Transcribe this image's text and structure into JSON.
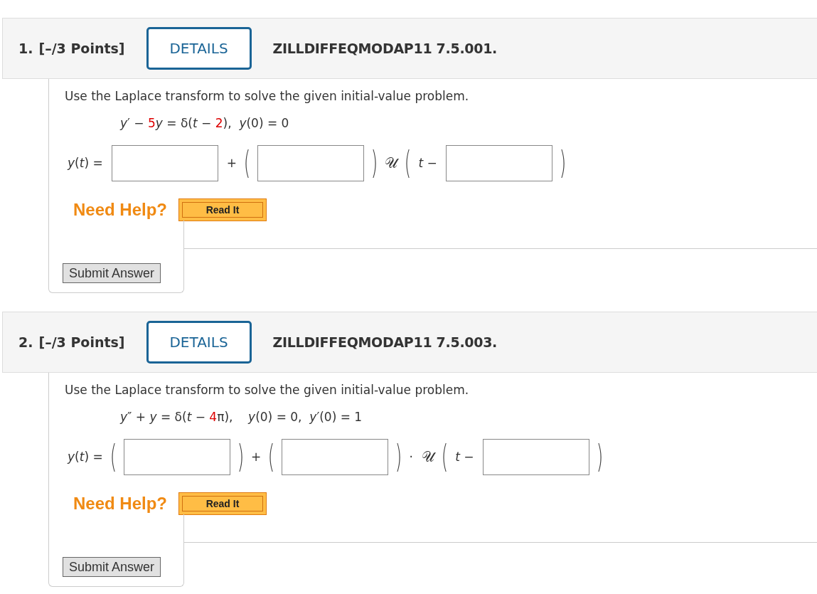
{
  "questions": [
    {
      "number": "1.",
      "points": "[–/3 Points]",
      "details": "DETAILS",
      "code": "ZILLDIFFEQMODAP11 7.5.001.",
      "prompt": "Use the Laplace transform to solve the given initial-value problem.",
      "equation": [
        {
          "kind": "plain",
          "text": "*y*′ − "
        },
        {
          "kind": "param",
          "text": "5"
        },
        {
          "kind": "plain",
          "text": "*y* = δ(*t* − "
        },
        {
          "kind": "param",
          "text": "2"
        },
        {
          "kind": "plain",
          "text": "),  *y*(0) = 0"
        }
      ],
      "answer": [
        {
          "kind": "text",
          "text": "*y*(*t*) ="
        },
        {
          "kind": "blank"
        },
        {
          "kind": "text",
          "text": "+"
        },
        {
          "kind": "paren",
          "text": "("
        },
        {
          "kind": "blank"
        },
        {
          "kind": "paren",
          "text": ")"
        },
        {
          "kind": "script",
          "text": "𝒰"
        },
        {
          "kind": "paren",
          "text": "("
        },
        {
          "kind": "text",
          "text": "*t* −"
        },
        {
          "kind": "blank"
        },
        {
          "kind": "paren",
          "text": ")"
        }
      ],
      "help": "Need Help?",
      "read_it": "Read It",
      "submit": "Submit Answer"
    },
    {
      "number": "2.",
      "points": "[–/3 Points]",
      "details": "DETAILS",
      "code": "ZILLDIFFEQMODAP11 7.5.003.",
      "prompt": "Use the Laplace transform to solve the given initial-value problem.",
      "equation": [
        {
          "kind": "plain",
          "text": "*y*″ + *y* = δ(*t* − "
        },
        {
          "kind": "param",
          "text": "4"
        },
        {
          "kind": "plain",
          "text": "π),    *y*(0) = 0,  *y*′(0) = 1"
        }
      ],
      "answer": [
        {
          "kind": "text",
          "text": "*y*(*t*) ="
        },
        {
          "kind": "paren",
          "text": "("
        },
        {
          "kind": "blank"
        },
        {
          "kind": "paren",
          "text": ")"
        },
        {
          "kind": "text",
          "text": "+"
        },
        {
          "kind": "paren",
          "text": "("
        },
        {
          "kind": "blank"
        },
        {
          "kind": "paren",
          "text": ")"
        },
        {
          "kind": "text",
          "text": "·"
        },
        {
          "kind": "script",
          "text": "𝒰"
        },
        {
          "kind": "paren",
          "text": "("
        },
        {
          "kind": "text",
          "text": "*t* −"
        },
        {
          "kind": "blank"
        },
        {
          "kind": "paren",
          "text": ")"
        }
      ],
      "help": "Need Help?",
      "read_it": "Read It",
      "submit": "Submit Answer"
    }
  ]
}
